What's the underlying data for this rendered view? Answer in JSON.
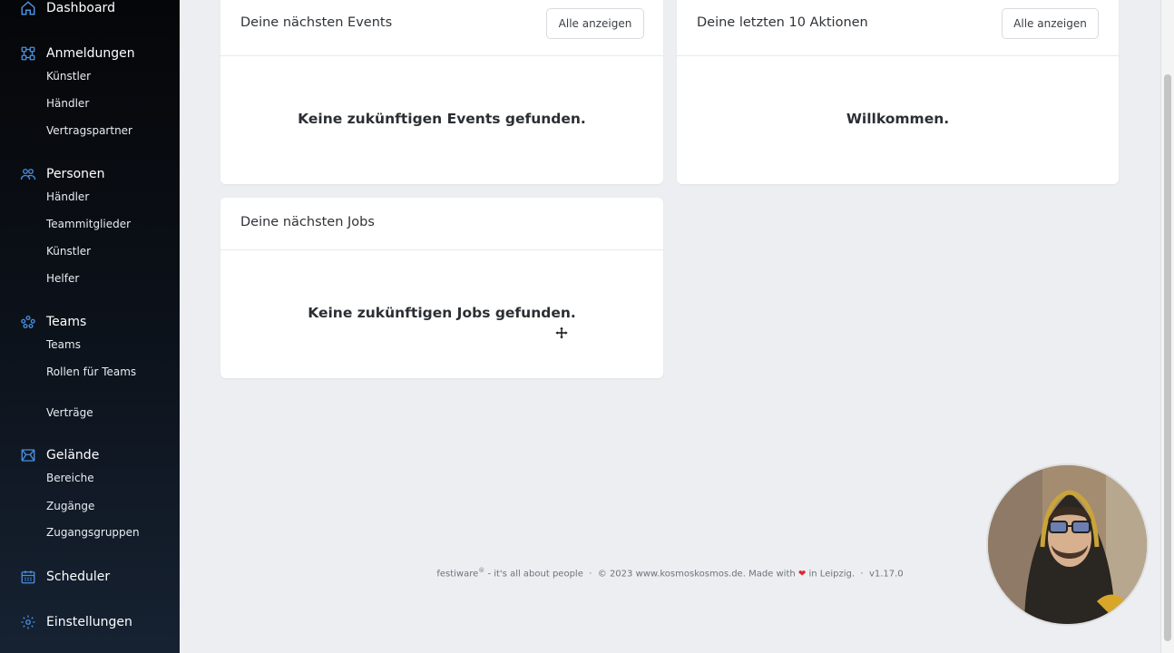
{
  "sidebar": {
    "dashboard": "Dashboard",
    "anmeldungen": {
      "label": "Anmeldungen",
      "items": [
        "Künstler",
        "Händler",
        "Vertragspartner"
      ]
    },
    "personen": {
      "label": "Personen",
      "items": [
        "Händler",
        "Teammitglieder",
        "Künstler",
        "Helfer"
      ]
    },
    "teams": {
      "label": "Teams",
      "items": [
        "Teams",
        "Rollen für Teams",
        "Verträge"
      ]
    },
    "gelaende": {
      "label": "Gelände",
      "items": [
        "Bereiche",
        "Zugänge",
        "Zugangsgruppen"
      ]
    },
    "scheduler": "Scheduler",
    "einstellungen": "Einstellungen"
  },
  "cards": {
    "events": {
      "title": "Deine nächsten Events",
      "button": "Alle anzeigen",
      "empty": "Keine zukünftigen Events gefunden."
    },
    "actions": {
      "title": "Deine letzten 10 Aktionen",
      "button": "Alle anzeigen",
      "empty": "Willkommen."
    },
    "jobs": {
      "title": "Deine nächsten Jobs",
      "empty": "Keine zukünftigen Jobs gefunden."
    }
  },
  "footer": {
    "brand": "festiware",
    "reg": "®",
    "tagline": " - it's all about people",
    "sep": "·",
    "copyright": "© 2023 www.kosmoskosmos.de. Made with",
    "location": "in Leipzig.",
    "version": "v1.17.0"
  },
  "colors": {
    "icon_blue": "#4a8fe0",
    "sidebar_bg": "#0b0f15",
    "main_bg": "#eceef2",
    "heart": "#e0262e"
  },
  "icons": {
    "dashboard": "home-icon",
    "anmeldungen": "network-icon",
    "personen": "people-icon",
    "teams": "teams-icon",
    "gelaende": "map-area-icon",
    "scheduler": "calendar-icon",
    "einstellungen": "gear-icon"
  }
}
